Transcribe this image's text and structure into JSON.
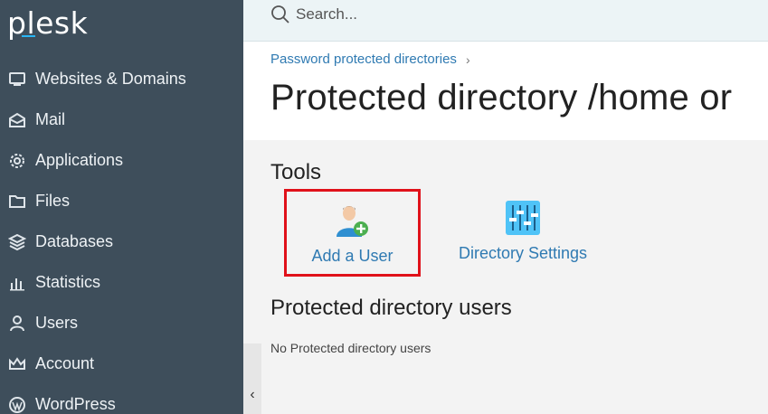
{
  "sidebar": {
    "logo": "plesk",
    "items": [
      {
        "label": "Websites & Domains",
        "icon": "monitor-icon"
      },
      {
        "label": "Mail",
        "icon": "envelope-icon"
      },
      {
        "label": "Applications",
        "icon": "gear-icon"
      },
      {
        "label": "Files",
        "icon": "folder-icon"
      },
      {
        "label": "Databases",
        "icon": "layers-icon"
      },
      {
        "label": "Statistics",
        "icon": "bar-chart-icon"
      },
      {
        "label": "Users",
        "icon": "user-icon"
      },
      {
        "label": "Account",
        "icon": "crown-icon"
      },
      {
        "label": "WordPress",
        "icon": "wordpress-icon"
      }
    ],
    "collapse_glyph": "‹"
  },
  "search": {
    "placeholder": "Search..."
  },
  "header": {
    "breadcrumb": "Password protected directories",
    "breadcrumb_separator": "›",
    "title": "Protected directory /home or"
  },
  "tools": {
    "title": "Tools",
    "add_user_label": "Add a User",
    "directory_settings_label": "Directory Settings"
  },
  "users_section": {
    "title": "Protected directory users",
    "empty_text": "No Protected directory users"
  },
  "colors": {
    "sidebar_bg": "#3e4e5b",
    "link": "#2f7ab2",
    "highlight": "#e0111a",
    "accent": "#29b6f6"
  }
}
